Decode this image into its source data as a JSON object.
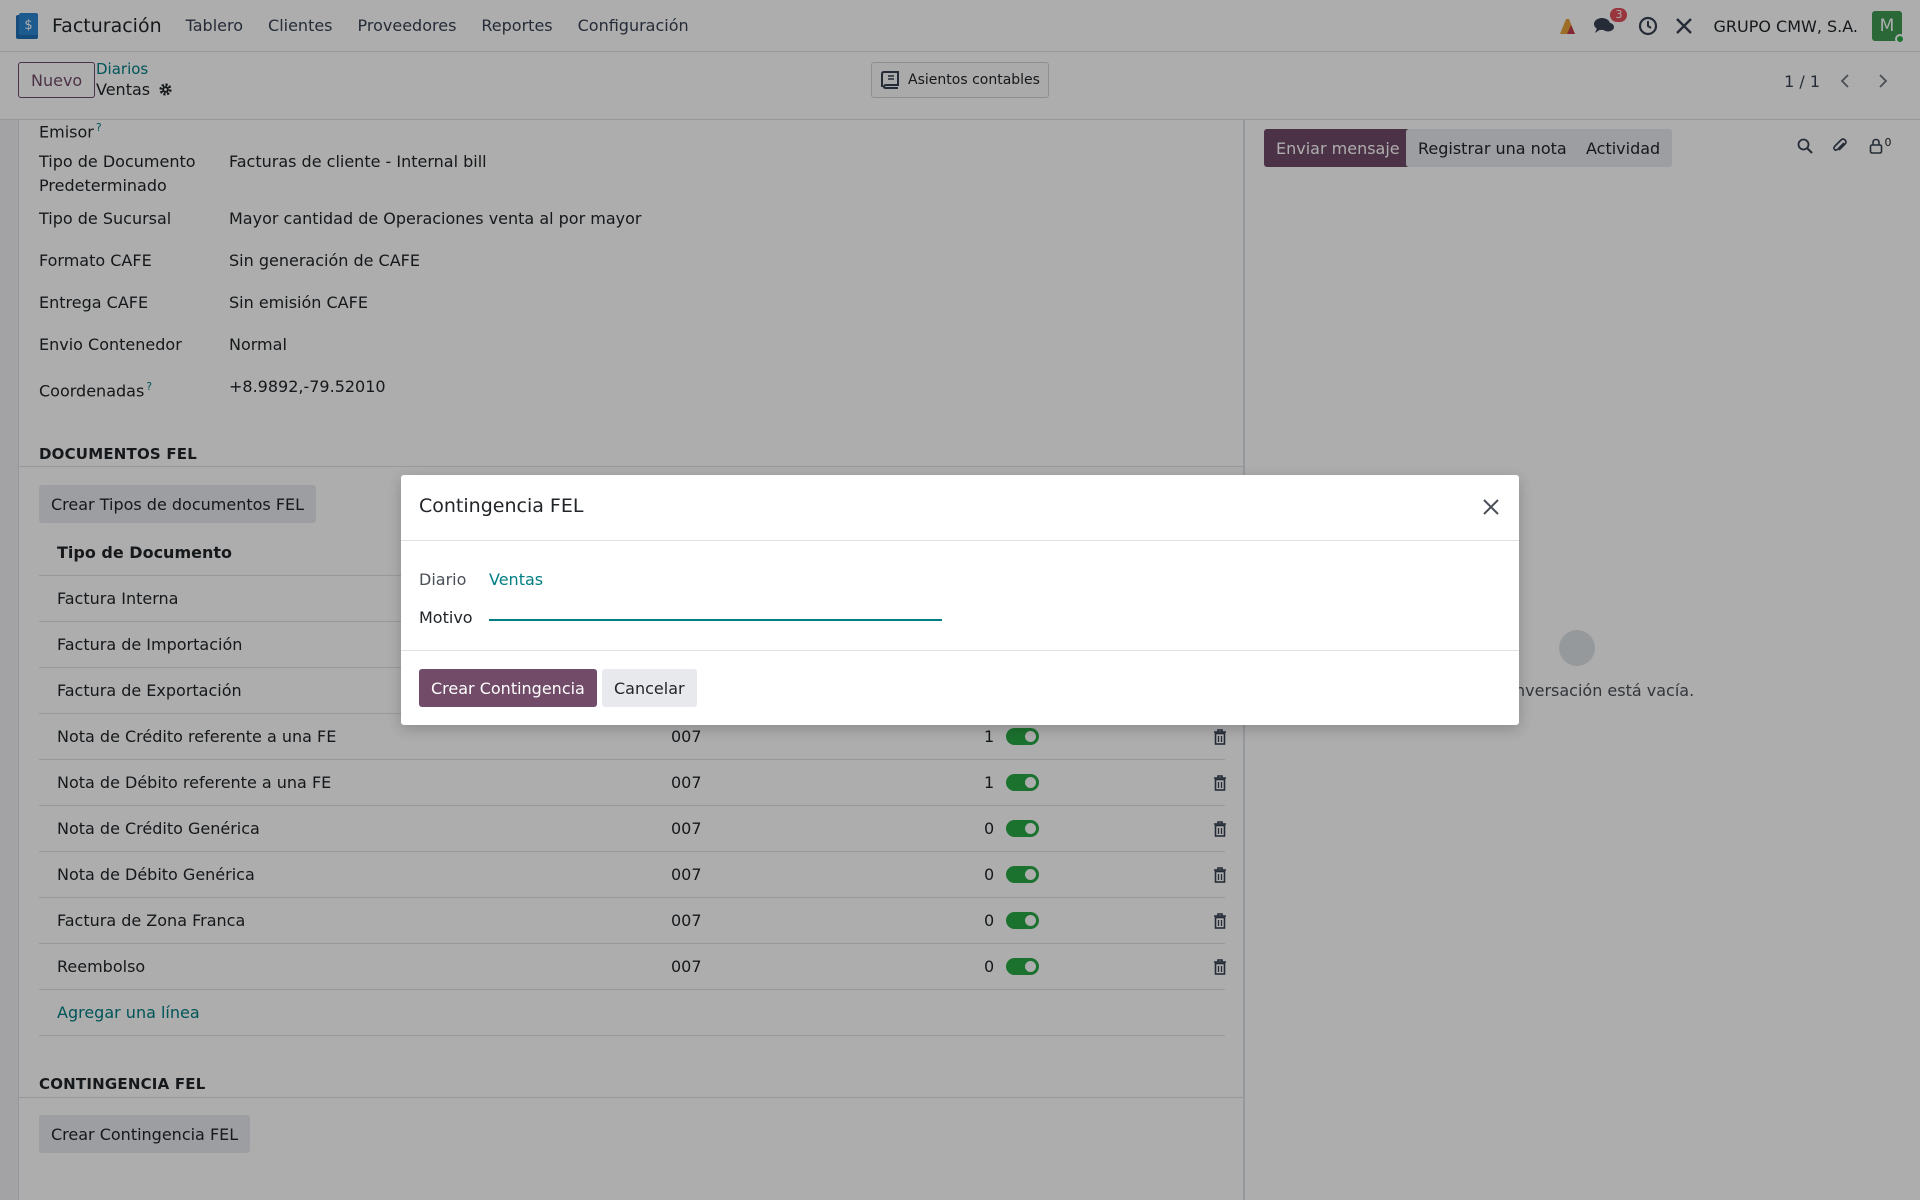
{
  "navbar": {
    "app_name": "Facturación",
    "menu": [
      "Tablero",
      "Clientes",
      "Proveedores",
      "Reportes",
      "Configuración"
    ],
    "messages_badge": "3",
    "company": "GRUPO CMW, S.A.",
    "avatar_initial": "M"
  },
  "control": {
    "new_button": "Nuevo",
    "breadcrumb_parent": "Diarios",
    "breadcrumb_current": "Ventas",
    "smart_button": "Asientos contables",
    "pager": "1 / 1"
  },
  "form": {
    "fields": [
      {
        "label": "Emisor",
        "help": "?",
        "value": ""
      },
      {
        "label": "Tipo de Documento Predeterminado",
        "help": "",
        "value": "Facturas de cliente - Internal bill"
      },
      {
        "label": "Tipo de Sucursal",
        "help": "",
        "value": "Mayor cantidad de Operaciones venta al por mayor"
      },
      {
        "label": "Formato CAFE",
        "help": "",
        "value": "Sin generación de CAFE"
      },
      {
        "label": "Entrega CAFE",
        "help": "",
        "value": "Sin emisión CAFE"
      },
      {
        "label": "Envio Contenedor",
        "help": "",
        "value": "Normal"
      },
      {
        "label": "Coordenadas",
        "help": "?",
        "value": "+8.9892,-79.52010"
      }
    ],
    "section_documents": "DOCUMENTOS FEL",
    "btn_create_types": "Crear Tipos de documentos FEL",
    "table_header_type": "Tipo de Documento",
    "rows": [
      {
        "name": "Factura Interna",
        "code": "",
        "num": ""
      },
      {
        "name": "Factura de Importación",
        "code": "",
        "num": ""
      },
      {
        "name": "Factura de Exportación",
        "code": "",
        "num": ""
      },
      {
        "name": "Nota de Crédito referente a una FE",
        "code": "007",
        "num": "1"
      },
      {
        "name": "Nota de Débito referente a una FE",
        "code": "007",
        "num": "1"
      },
      {
        "name": "Nota de Crédito Genérica",
        "code": "007",
        "num": "0"
      },
      {
        "name": "Nota de Débito Genérica",
        "code": "007",
        "num": "0"
      },
      {
        "name": "Factura de Zona Franca",
        "code": "007",
        "num": "0"
      },
      {
        "name": "Reembolso",
        "code": "007",
        "num": "0"
      }
    ],
    "add_line": "Agregar una línea",
    "section_contingency": "CONTINGENCIA FEL",
    "btn_create_contingency": "Crear Contingencia FEL"
  },
  "chatter": {
    "send_message": "Enviar mensaje",
    "log_note": "Registrar una nota",
    "activity": "Actividad",
    "followers_count": "0",
    "empty_text": "nversación está vacía."
  },
  "modal": {
    "title": "Contingencia FEL",
    "journal_label": "Diario",
    "journal_value": "Ventas",
    "reason_label": "Motivo",
    "reason_value": "",
    "btn_create": "Crear Contingencia",
    "btn_cancel": "Cancelar"
  },
  "colors": {
    "primary": "#714b67",
    "link": "#017e84",
    "toggle_on": "#28a745"
  }
}
